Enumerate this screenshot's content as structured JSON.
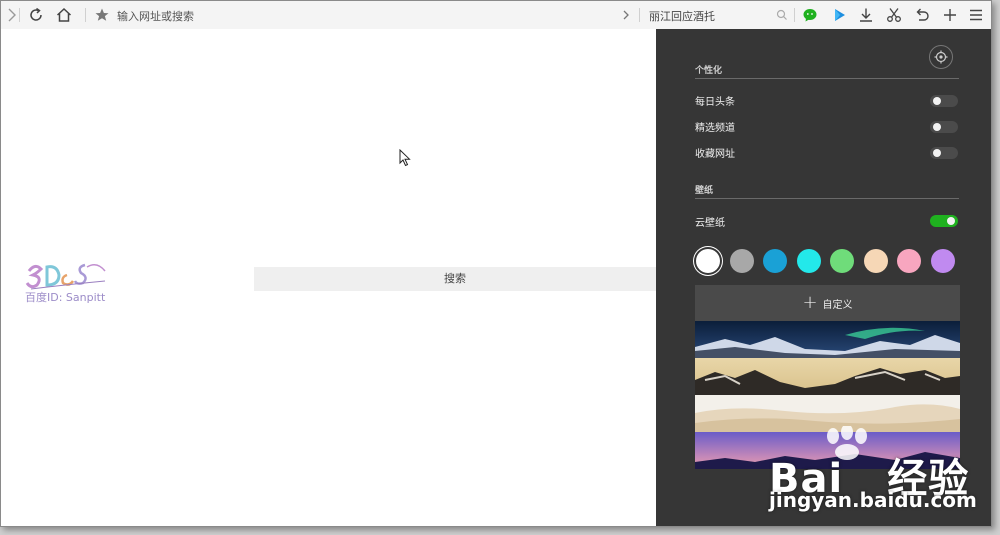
{
  "toolbar": {
    "address_placeholder": "输入网址或搜索",
    "search_query": "丽江回应酒托",
    "icons": [
      "forward-icon",
      "refresh-icon",
      "home-icon",
      "star-icon",
      "chevron-right-icon",
      "search-icon",
      "wechat-icon",
      "video-icon",
      "download-icon",
      "scissors-icon",
      "undo-icon",
      "new-tab-icon",
      "menu-icon"
    ]
  },
  "content": {
    "search_button_label": "搜索",
    "watermark_id": "百度ID: Sanpitt"
  },
  "panel": {
    "personalize_title": "个性化",
    "toggles": [
      {
        "label": "每日头条",
        "on": false
      },
      {
        "label": "精选频道",
        "on": false
      },
      {
        "label": "收藏网址",
        "on": false
      }
    ],
    "wallpaper_title": "壁纸",
    "cloud_wallpaper_label": "云壁纸",
    "cloud_wallpaper_on": true,
    "color_swatches": [
      "#ffffff",
      "#a8a8a8",
      "#1aa1d6",
      "#23e8ea",
      "#6fdc7a",
      "#f6d7b6",
      "#f8a6bf",
      "#c08af0"
    ],
    "selected_swatch": 0,
    "custom_label": "自定义",
    "wallpapers": [
      "aurora-mountains",
      "rocky-desert",
      "sand-dunes",
      "purple-dusk-mountains"
    ]
  },
  "baidu_watermark": {
    "brand": "Bai",
    "brand_suffix": "经验",
    "url": "jingyan.baidu.com"
  }
}
